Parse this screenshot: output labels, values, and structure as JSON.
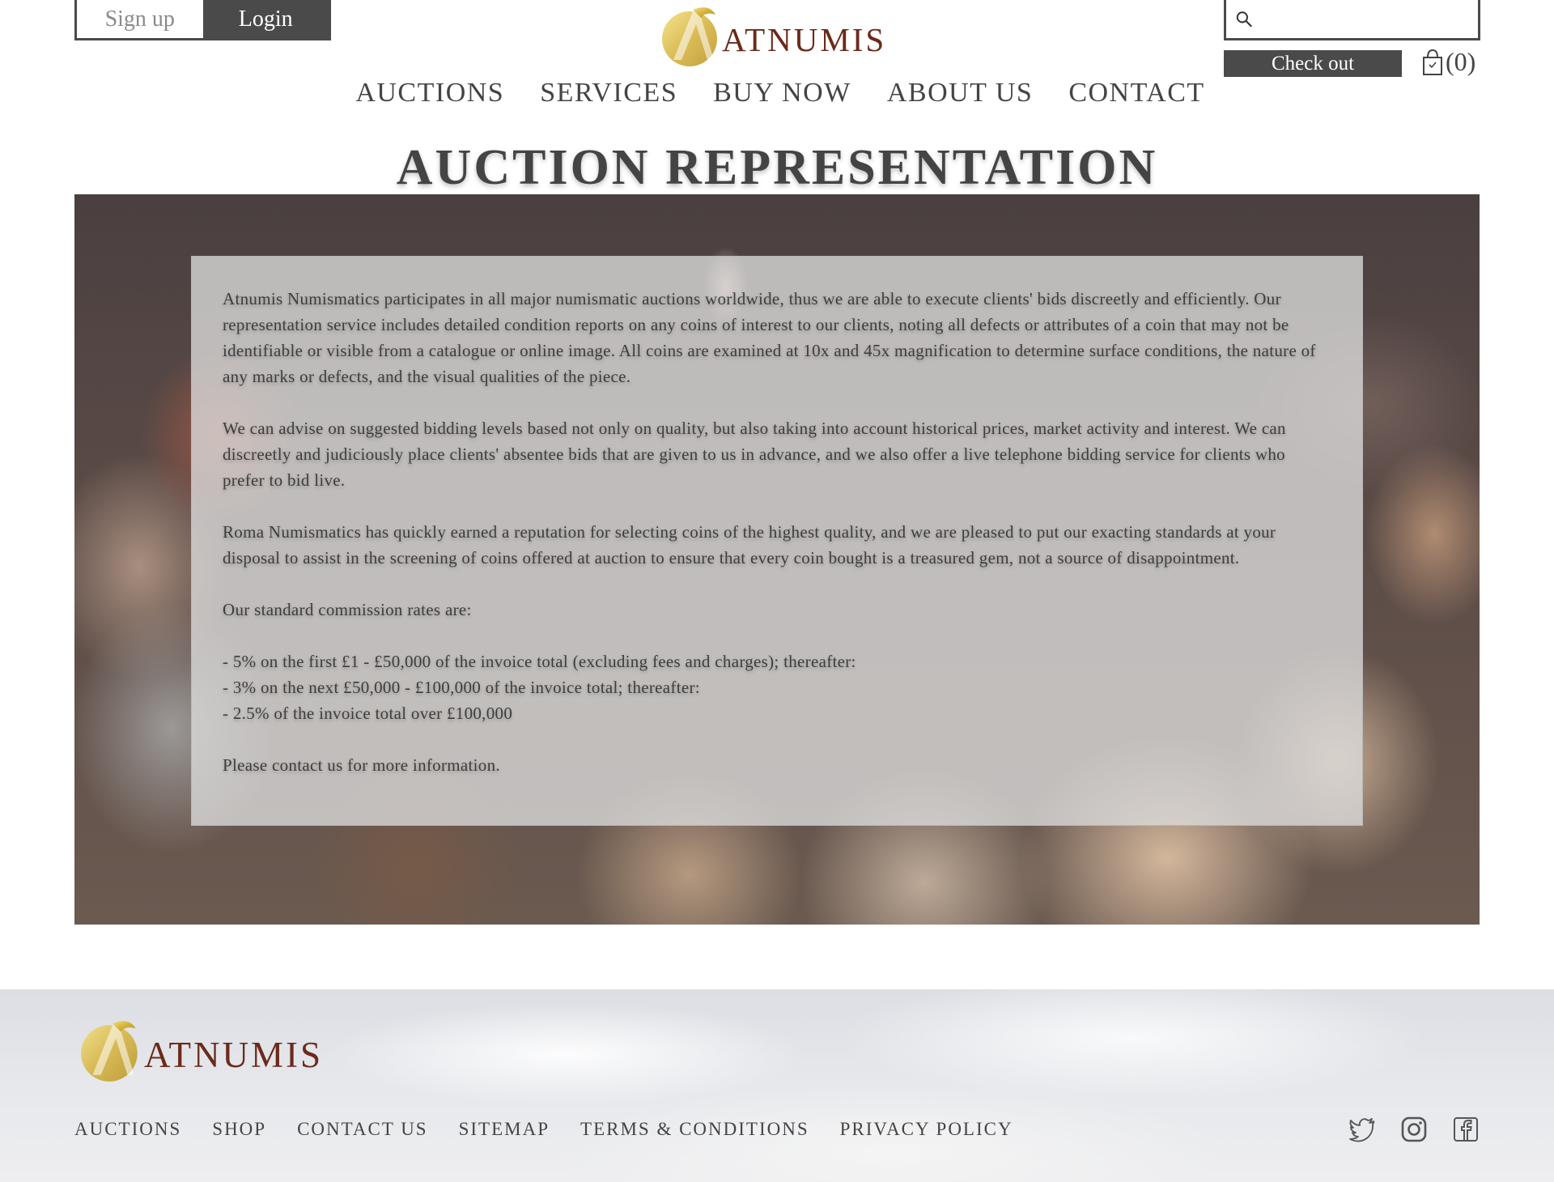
{
  "header": {
    "signup_label": "Sign up",
    "login_label": "Login",
    "logo_text": "ATNUMIS",
    "search_placeholder": "",
    "checkout_label": "Check out",
    "cart_count": "(0)"
  },
  "nav": [
    "AUCTIONS",
    "SERVICES",
    "BUY NOW",
    "ABOUT US",
    "CONTACT"
  ],
  "page": {
    "title": "AUCTION REPRESENTATION",
    "paragraphs": [
      "Atnumis Numismatics participates in all major numismatic auctions worldwide, thus we are able to execute clients' bids discreetly and efficiently. Our representation service includes detailed condition reports on any coins of interest to our clients, noting all defects or attributes of a coin that may not be identifiable or visible from a catalogue or online image. All coins are examined at 10x and 45x magnification to determine surface conditions, the nature of any marks or defects, and the visual qualities of the piece.",
      "We can advise on suggested bidding levels based not only on quality, but also taking into account historical prices, market activity and interest. We can discreetly and judiciously place clients' absentee bids that are given to us in advance, and we also offer a live telephone bidding service for clients who prefer to bid live.",
      "Roma Numismatics has quickly earned a reputation for selecting coins of the highest quality, and we are pleased to put our exacting standards at your disposal to assist in the screening of coins offered at auction to ensure that every coin bought is a treasured gem, not a source of disappointment.",
      "Our standard commission rates are:"
    ],
    "rates": [
      "- 5% on the first £1 - £50,000 of the invoice total (excluding fees and charges); thereafter:",
      "- 3% on the next £50,000 - £100,000 of the invoice total; thereafter:",
      "- 2.5% of the invoice total over £100,000"
    ],
    "closing": "Please contact us for more information."
  },
  "footer": {
    "logo_text": "ATNUMIS",
    "links": [
      "AUCTIONS",
      "SHOP",
      "CONTACT US",
      "SITEMAP",
      "TERMS & CONDITIONS",
      "PRIVACY POLICY"
    ],
    "social_icons": [
      "twitter-icon",
      "instagram-icon",
      "facebook-icon"
    ]
  },
  "colors": {
    "dark": "#4a4a4a",
    "text": "#444444",
    "logo_gold": "#d4b13a",
    "logo_brown": "#6b2a1a"
  }
}
